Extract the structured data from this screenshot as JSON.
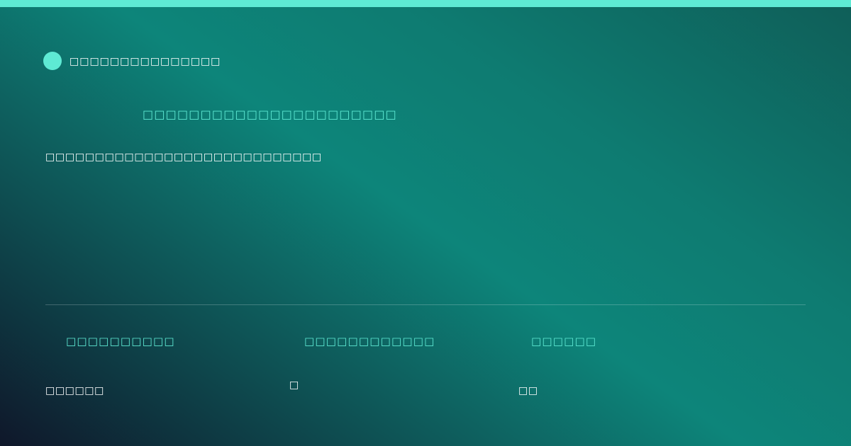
{
  "theme": {
    "accent": "#5eead4",
    "background_start": "#0f172a",
    "background_mid": "#0d857a",
    "background_end": "#0f5e58"
  },
  "brand": {
    "logo_icon": "circle-dot-icon",
    "name": "□□□□□□□□□□□□□□□"
  },
  "headline": "□□□□□□□□□□□□□□□□□□□□□□",
  "subline": "□□□□□□□□□□□□□□□□□□□□□□□□□□□□",
  "stats": [
    {
      "label": "□□□□□□□□□□",
      "value": "□□□□□□"
    },
    {
      "label": "□□□□□□□□□□□□",
      "value": "□"
    },
    {
      "label": "□□□□□□",
      "value": "□□"
    }
  ]
}
